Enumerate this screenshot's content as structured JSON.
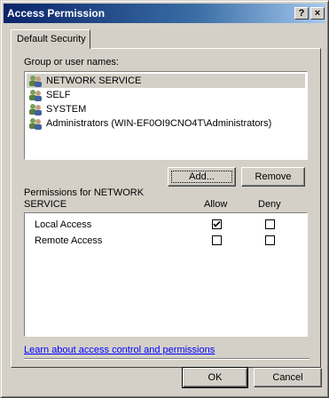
{
  "window": {
    "title": "Access Permission",
    "help_label": "?",
    "close_label": "×"
  },
  "tab": {
    "label": "Default Security"
  },
  "groups": {
    "label": "Group or user names:",
    "items": [
      {
        "label": "NETWORK SERVICE",
        "selected": true
      },
      {
        "label": "SELF",
        "selected": false
      },
      {
        "label": "SYSTEM",
        "selected": false
      },
      {
        "label": "Administrators (WIN-EF0OI9CNO4T\\Administrators)",
        "selected": false
      }
    ]
  },
  "buttons": {
    "add": "Add...",
    "remove": "Remove",
    "ok": "OK",
    "cancel": "Cancel"
  },
  "permissions": {
    "label_line1": "Permissions for NETWORK",
    "label_line2": "SERVICE",
    "allow_header": "Allow",
    "deny_header": "Deny",
    "rows": [
      {
        "label": "Local Access",
        "allow": true,
        "deny": false
      },
      {
        "label": "Remote Access",
        "allow": false,
        "deny": false
      }
    ]
  },
  "link": "Learn about access control and permissions"
}
